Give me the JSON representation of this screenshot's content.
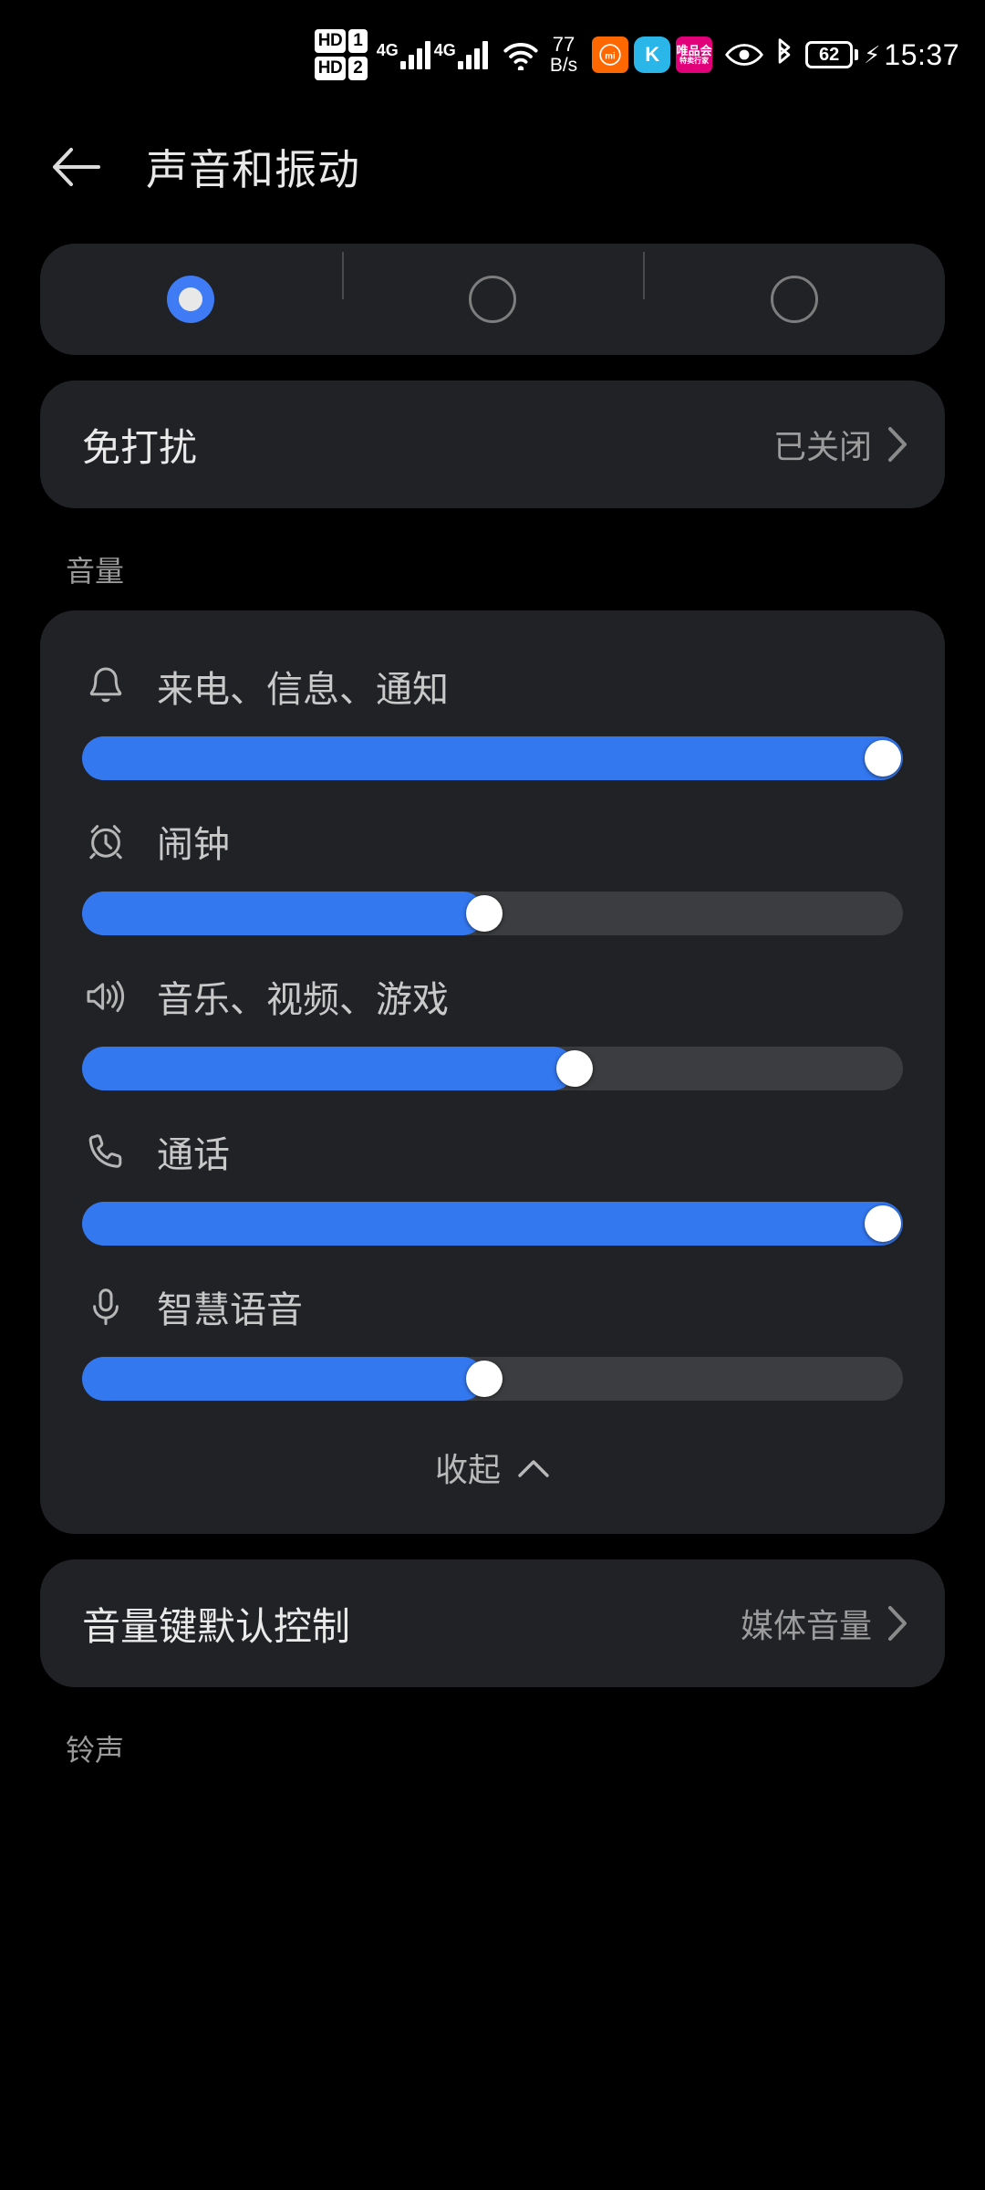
{
  "status_bar": {
    "hd_badges": [
      {
        "label": "HD",
        "num": "1"
      },
      {
        "label": "HD",
        "num": "2"
      }
    ],
    "sim1_network": "4G",
    "sim2_network": "4G",
    "wifi_icon": "wifi-icon",
    "network_speed_value": "77",
    "network_speed_unit": "B/s",
    "app_icons": [
      {
        "name": "xiaomi-app-icon",
        "glyph": "mi"
      },
      {
        "name": "kugou-app-icon",
        "glyph": "K"
      },
      {
        "name": "vipshop-app-icon",
        "glyph": "唯品会",
        "sub": "特卖行家"
      }
    ],
    "eye_icon": "eye-protection-icon",
    "bluetooth_icon": "bluetooth-icon",
    "battery_level": "62",
    "charging_icon": "charging-bolt-icon",
    "time": "15:37"
  },
  "header": {
    "back_icon": "back-arrow-icon",
    "title": "声音和振动"
  },
  "sound_mode": {
    "options": [
      {
        "name": "ring-mode",
        "selected": true
      },
      {
        "name": "vibrate-mode",
        "selected": false
      },
      {
        "name": "silent-mode",
        "selected": false
      }
    ]
  },
  "dnd_row": {
    "title": "免打扰",
    "value": "已关闭",
    "chevron": "chevron-right-icon"
  },
  "volume": {
    "section_label": "音量",
    "items": [
      {
        "icon": "bell-icon",
        "label": "来电、信息、通知",
        "percent": 100
      },
      {
        "icon": "alarm-clock-icon",
        "label": "闹钟",
        "percent": 49
      },
      {
        "icon": "speaker-icon",
        "label": "音乐、视频、游戏",
        "percent": 60
      },
      {
        "icon": "phone-icon",
        "label": "通话",
        "percent": 100
      },
      {
        "icon": "microphone-icon",
        "label": "智慧语音",
        "percent": 49
      }
    ],
    "collapse_label": "收起",
    "collapse_icon": "chevron-up-icon"
  },
  "volume_key_row": {
    "title": "音量键默认控制",
    "value": "媒体音量",
    "chevron": "chevron-right-icon"
  },
  "ringtone": {
    "section_label": "铃声"
  },
  "colors": {
    "accent": "#3478f0",
    "card_bg": "#212225",
    "page_bg": "#000000",
    "track": "#3c3d40"
  }
}
